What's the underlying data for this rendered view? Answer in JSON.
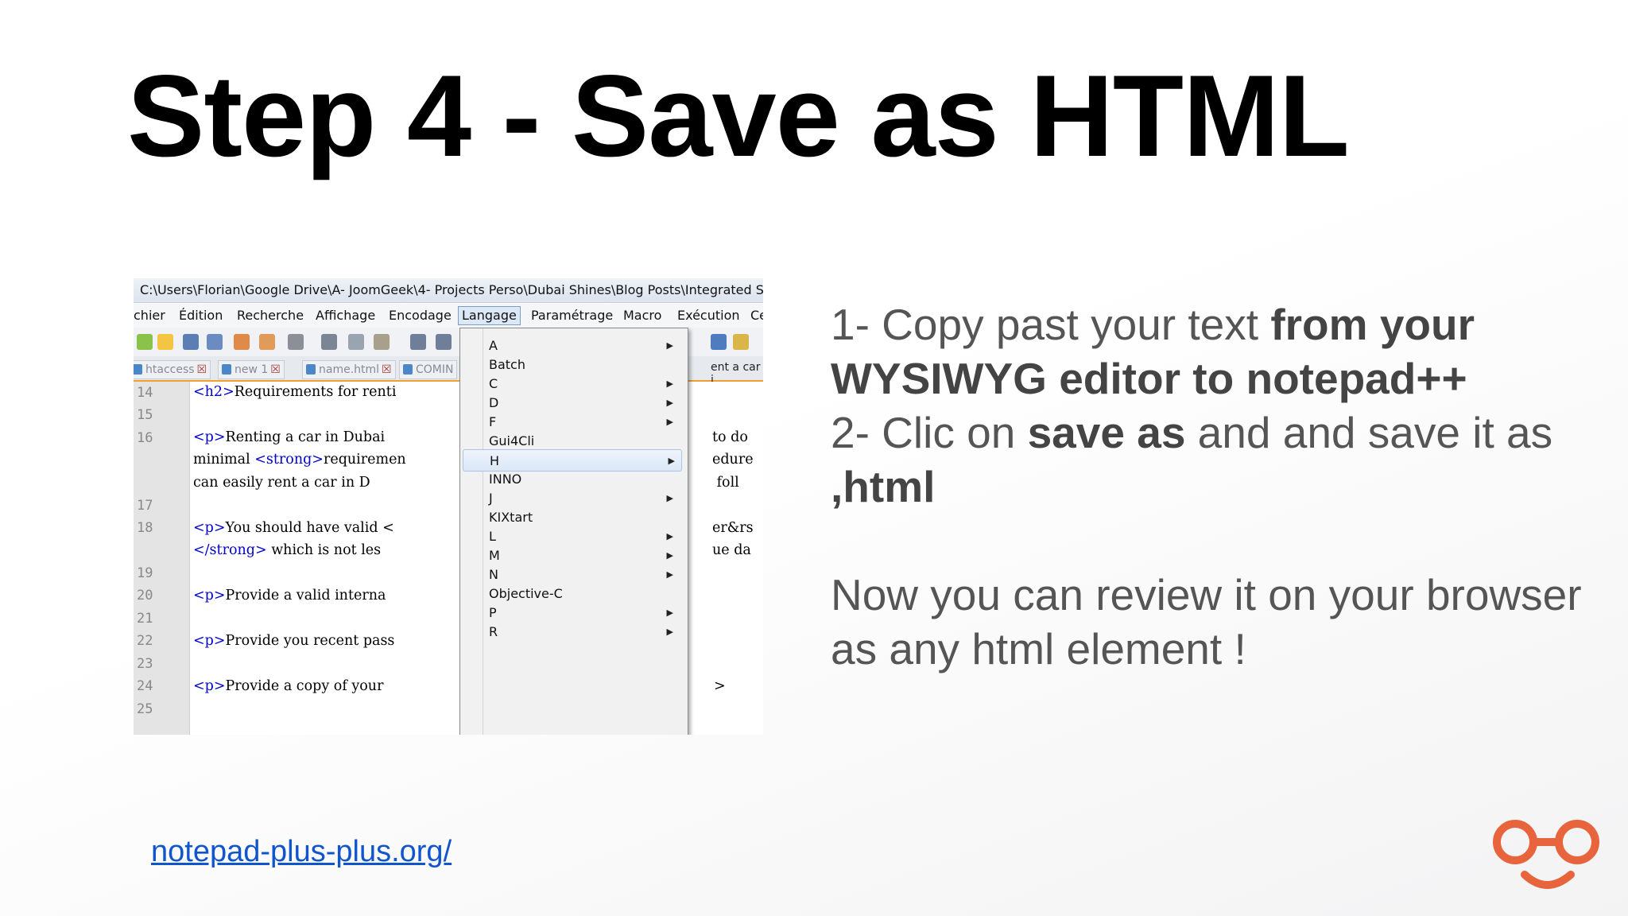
{
  "slide": {
    "title": "Step 4 - Save as HTML",
    "link": "notepad-plus-plus.org/",
    "instructions": {
      "line1_a": "1- Copy past your text ",
      "line1_b": "from your WYSIWYG editor to notepad++",
      "line2_a": "2- Clic on ",
      "line2_b": "save as",
      "line2_c": " and and save it as ",
      "line2_d": ",html",
      "line3": "Now you can review it on your browser as any html element !"
    },
    "logo_color": "#e8643c"
  },
  "screenshot": {
    "window_title": "C:\\Users\\Florian\\Google Drive\\A- JoomGeek\\4- Projects Perso\\Dubai Shines\\Blog Posts\\Integrated SEO",
    "menubar": [
      "chier",
      "Édition",
      "Recherche",
      "Affichage",
      "Encodage",
      "Langage",
      "Paramétrage",
      "Macro",
      "Exécution",
      "Ce"
    ],
    "toolbar_icons": [
      "new-file-icon",
      "open-file-icon",
      "save-icon",
      "save-all-icon",
      "close-icon",
      "close-all-icon",
      "print-icon",
      "cut-icon",
      "copy-icon",
      "paste-icon",
      "undo-icon",
      "redo-icon"
    ],
    "tabs": [
      {
        "label": "htaccess",
        "close": "☒"
      },
      {
        "label": "new   1",
        "close": "☒"
      },
      {
        "label": "name.html",
        "close": "☒"
      },
      {
        "label": "COMIN",
        "close": ""
      }
    ],
    "right_tab_label": "ent a car i",
    "line_numbers": [
      "14",
      "15",
      "16",
      "",
      "",
      "17",
      "18",
      "",
      "19",
      "20",
      "21",
      "22",
      "23",
      "24",
      "25"
    ],
    "code_lines": [
      {
        "tag": "<h2>",
        "text": "Requirements for renti"
      },
      {
        "tag": "",
        "text": ""
      },
      {
        "tag": "<p>",
        "text": "Renting a car in Dubai "
      },
      {
        "tag": "",
        "text": "minimal ",
        "tag2": "<strong>",
        "text2": "requiremen"
      },
      {
        "tag": "",
        "text": "can easily rent a car in D"
      },
      {
        "tag": "",
        "text": ""
      },
      {
        "tag": "<p>",
        "text": "You should have valid <"
      },
      {
        "tag": "</strong>",
        "text": " which is not les"
      },
      {
        "tag": "",
        "text": ""
      },
      {
        "tag": "<p>",
        "text": "Provide a valid interna"
      },
      {
        "tag": "",
        "text": ""
      },
      {
        "tag": "<p>",
        "text": "Provide you recent pass"
      },
      {
        "tag": "",
        "text": ""
      },
      {
        "tag": "<p>",
        "text": "Provide a copy of your "
      },
      {
        "tag": "",
        "text": ""
      }
    ],
    "right_code": [
      "to do",
      "edure",
      " foll",
      "er&rs",
      "ue da",
      ">"
    ],
    "language_menu": [
      {
        "label": "A",
        "submenu": true
      },
      {
        "label": "Batch",
        "submenu": false
      },
      {
        "label": "C",
        "submenu": true
      },
      {
        "label": "D",
        "submenu": true
      },
      {
        "label": "F",
        "submenu": true
      },
      {
        "label": "Gui4Cli",
        "submenu": false
      },
      {
        "label": "H",
        "submenu": true,
        "highlighted": true
      },
      {
        "label": "INNO",
        "submenu": false
      },
      {
        "label": "J",
        "submenu": true
      },
      {
        "label": "KIXtart",
        "submenu": false
      },
      {
        "label": "L",
        "submenu": true
      },
      {
        "label": "M",
        "submenu": true
      },
      {
        "label": "N",
        "submenu": true
      },
      {
        "label": "Objective-C",
        "submenu": false
      },
      {
        "label": "P",
        "submenu": true
      },
      {
        "label": "R",
        "submenu": true
      }
    ]
  }
}
